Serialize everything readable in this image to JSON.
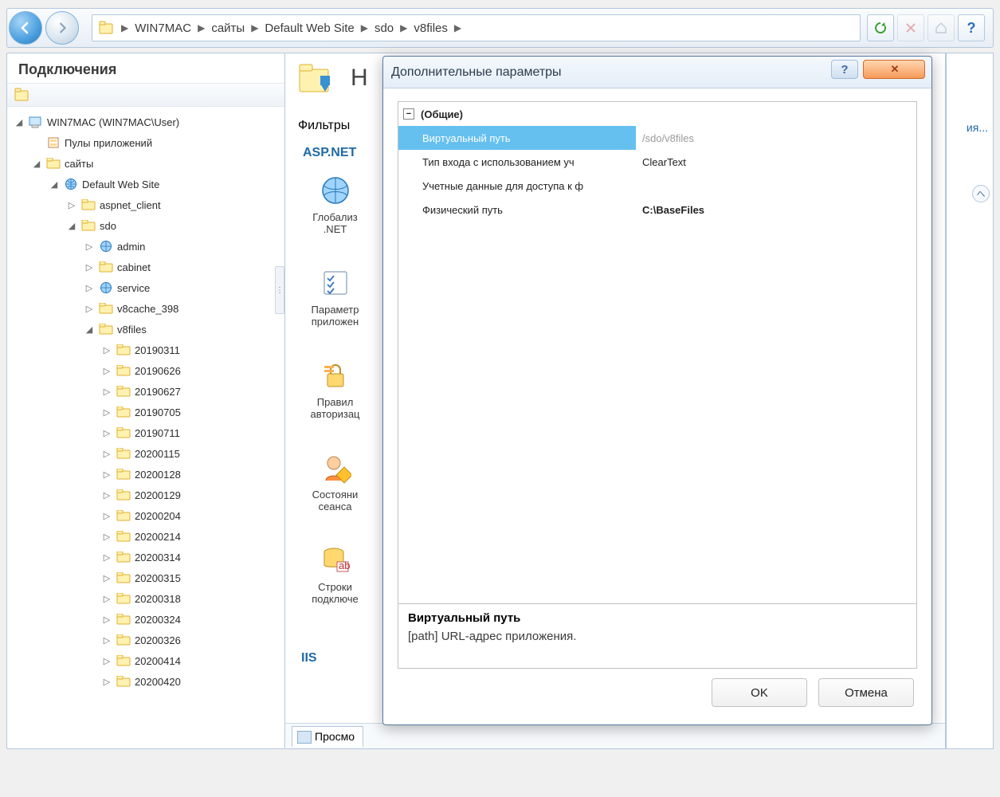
{
  "breadcrumb": {
    "segments": [
      "WIN7MAC",
      "сайты",
      "Default Web Site",
      "sdo",
      "v8files"
    ]
  },
  "connections": {
    "title": "Подключения",
    "root": "WIN7MAC (WIN7MAC\\User)",
    "appPools": "Пулы приложений",
    "sites": "сайты",
    "defaultSite": "Default Web Site",
    "aspnetClient": "aspnet_client",
    "sdo": "sdo",
    "sdoChildren": [
      "admin",
      "cabinet",
      "service",
      "v8cache_398",
      "v8files"
    ],
    "v8filesFolders": [
      "20190311",
      "20190626",
      "20190627",
      "20190705",
      "20190711",
      "20200115",
      "20200128",
      "20200129",
      "20200204",
      "20200214",
      "20200314",
      "20200315",
      "20200318",
      "20200324",
      "20200326",
      "20200414",
      "20200420"
    ]
  },
  "main": {
    "headerLetter": "Н",
    "filters": "Фильтры",
    "aspnet": "ASP.NET",
    "features": [
      {
        "label": "Глобализ\n.NET"
      },
      {
        "label": "Параметр\nприложен"
      },
      {
        "label": "Правил\nавторизац"
      },
      {
        "label": "Состояни\nсеанса"
      },
      {
        "label": "Строки\nподключе"
      }
    ],
    "iis": "IIS",
    "viewTab": "Просмо"
  },
  "actions": {
    "truncated": "ия..."
  },
  "dialog": {
    "title": "Дополнительные параметры",
    "group": "(Общие)",
    "rows": [
      {
        "name": "Виртуальный путь",
        "value": "/sdo/v8files",
        "selected": true,
        "grayValue": true
      },
      {
        "name": "Тип входа с использованием уч",
        "value": "ClearText"
      },
      {
        "name": "Учетные данные для доступа к ф",
        "value": ""
      },
      {
        "name": "Физический путь",
        "value": "C:\\BaseFiles",
        "bold": true
      }
    ],
    "desc": {
      "title": "Виртуальный путь",
      "text": "[path] URL-адрес приложения."
    },
    "ok": "OK",
    "cancel": "Отмена"
  }
}
